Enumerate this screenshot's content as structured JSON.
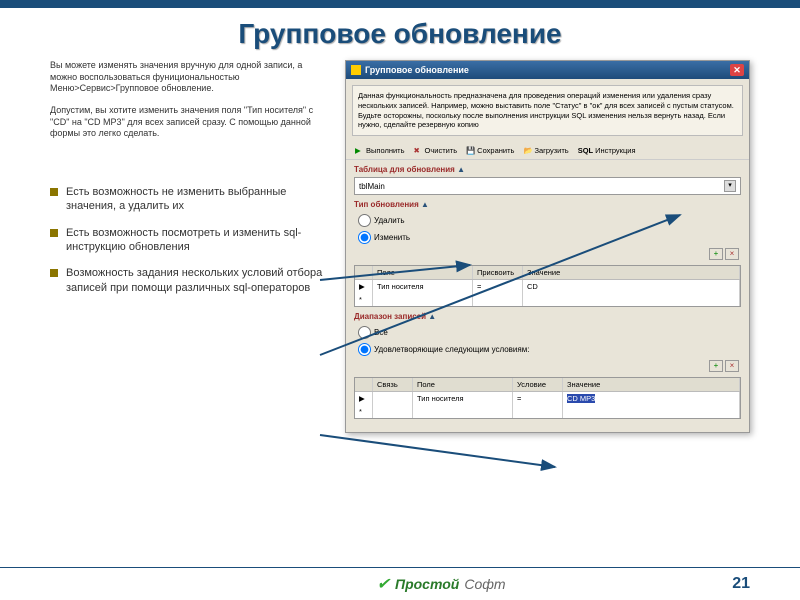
{
  "title": "Групповое обновление",
  "intro": {
    "p1": "Вы можете изменять значения вручную для одной записи, а можно воспользоваться фунициональностью Меню>Сервис>Групповое обновление.",
    "p2": "Допустим, вы хотите изменить значения поля \"Тип носителя\" с \"CD\" на \"CD MP3\" для всех записей сразу. С помощью данной формы это легко сделать."
  },
  "bullets": {
    "b1": "Есть возможность не изменить выбранные значения, а удалить их",
    "b2": "Есть возможность посмотреть и изменить sql-инструкцию обновления",
    "b3": "Возможность задания нескольких условий отбора записей при помощи различных sql-операторов"
  },
  "window": {
    "title": "Групповое обновление",
    "info": "Данная функциональность предназначена для проведения операций изменения или удаления сразу нескольких записей. Например, можно выставить поле \"Статус\" в \"ок\" для всех записей с пустым статусом. Будьте осторожны, поскольку после выполнения инструкции SQL изменения нельзя вернуть назад. Если нужно, сделайте резервную копию"
  },
  "toolbar": {
    "run": "Выполнить",
    "clear": "Очистить",
    "save": "Сохранить",
    "load": "Загрузить",
    "sql": "SQL",
    "instruction": "Инструкция"
  },
  "sections": {
    "table_label": "Таблица для обновления",
    "table_value": "tblMain",
    "type_label": "Тип обновления",
    "radio_delete": "Удалить",
    "radio_update": "Изменить",
    "range_label": "Диапазон записей",
    "radio_all": "Все",
    "radio_cond": "Удовлетворяющие следующим условиям:"
  },
  "grid1": {
    "h1": "Поле",
    "h2": "Присвоить",
    "h3": "Значение",
    "r1c1": "Тип носителя",
    "r1c2": "=",
    "r1c3": "CD"
  },
  "grid2": {
    "h0": "Связь",
    "h1": "Поле",
    "h2": "Условие",
    "h3": "Значение",
    "r1c1": "Тип носителя",
    "r1c2": "=",
    "r1c3": "CD MP3"
  },
  "footer": {
    "brand1": "Простой",
    "brand2": "Софт",
    "page": "21"
  }
}
